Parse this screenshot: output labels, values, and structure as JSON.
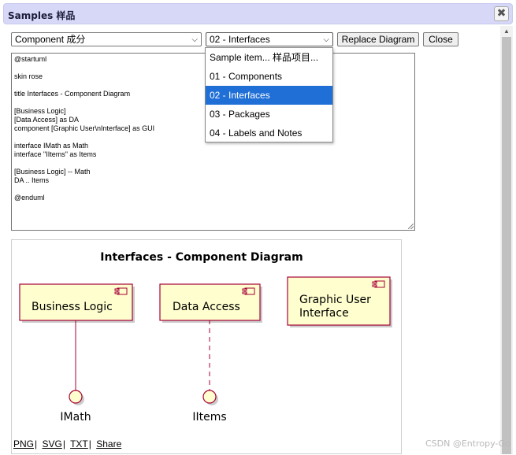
{
  "window": {
    "title": "Samples 样品",
    "close_glyph": "✖"
  },
  "toolbar": {
    "category_select": {
      "value": "Component 成分"
    },
    "sample_select": {
      "value": "02 - Interfaces"
    },
    "replace_label": "Replace Diagram",
    "close_label": "Close"
  },
  "dropdown": {
    "items": [
      {
        "label": "Sample item... 样品项目...",
        "selected": false
      },
      {
        "label": "01 - Components",
        "selected": false
      },
      {
        "label": "02 - Interfaces",
        "selected": true
      },
      {
        "label": "03 - Packages",
        "selected": false
      },
      {
        "label": "04 - Labels and Notes",
        "selected": false
      }
    ]
  },
  "editor": {
    "text": "@startuml\n\nskin rose\n\ntitle Interfaces - Component Diagram\n\n[Business Logic]\n[Data Access] as DA\ncomponent [Graphic User\\nInterface] as GUI\n\ninterface IMath as Math\ninterface \"IItems\" as Items\n\n[Business Logic] -- Math\nDA .. Items\n\n@enduml"
  },
  "diagram": {
    "title": "Interfaces - Component Diagram",
    "colors": {
      "fill": "#fefece",
      "border": "#a80036",
      "line": "#a80036"
    },
    "components": [
      {
        "name": "business-logic",
        "lines": [
          "Business Logic"
        ]
      },
      {
        "name": "data-access",
        "lines": [
          "Data Access"
        ]
      },
      {
        "name": "graphic-user-interface",
        "lines": [
          "Graphic User",
          "Interface"
        ]
      }
    ],
    "interfaces": [
      {
        "name": "imath",
        "label": "IMath",
        "link_style": "solid"
      },
      {
        "name": "iitems",
        "label": "IItems",
        "link_style": "dashed"
      }
    ]
  },
  "export_links": [
    "PNG",
    "SVG",
    "TXT",
    "Share"
  ],
  "watermark": "CSDN @Entropy-Go"
}
